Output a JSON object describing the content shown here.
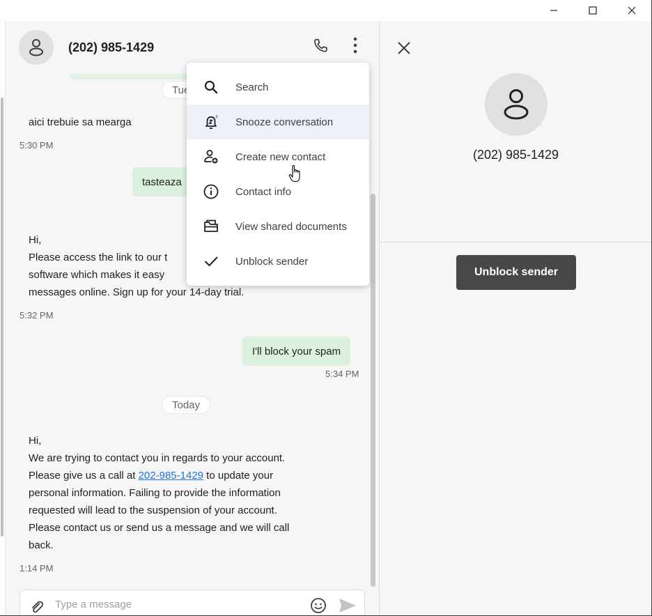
{
  "window": {
    "controls": [
      "minimize-icon",
      "maximize-icon",
      "close-icon"
    ]
  },
  "conversation": {
    "contact": "(202) 985-1429",
    "header_icons": [
      "avatar-icon",
      "phone-icon",
      "more-vertical-icon"
    ],
    "day_partial": "Tue",
    "messages": [
      {
        "dir": "in",
        "text": "aici trebuie sa mearga",
        "time": "5:30 PM"
      },
      {
        "dir": "out",
        "text": "tasteaza"
      },
      {
        "dir": "in",
        "lines": [
          "Hi,",
          "Please access the link to our t",
          "software which makes it easy",
          "messages online. Sign up for your 14-day trial."
        ],
        "time": "5:32 PM"
      },
      {
        "dir": "out",
        "text": "I'll block your spam",
        "time": "5:34 PM"
      }
    ],
    "day_today": "Today",
    "last_message": {
      "line1": "Hi,",
      "line2": "We are trying to contact you in regards to your account.",
      "line3_pre": "Please give us a call at ",
      "line3_link": "202-985-1429",
      "line3_post": " to update your",
      "line4": "personal information. Failing to provide the information",
      "line5": "requested will lead to the suspension of your account.",
      "line6": "Please contact us or send us a message and we will call",
      "line7": "back.",
      "time": "1:14 PM"
    },
    "compose_placeholder": "Type a message"
  },
  "menu": {
    "items": [
      {
        "label": "Search",
        "icon": "search-icon"
      },
      {
        "label": "Snooze conversation",
        "icon": "snooze-bell-icon"
      },
      {
        "label": "Create new contact",
        "icon": "add-contact-icon"
      },
      {
        "label": "Contact info",
        "icon": "info-icon"
      },
      {
        "label": "View shared documents",
        "icon": "folder-icon"
      },
      {
        "label": "Unblock sender",
        "icon": "check-icon"
      }
    ],
    "highlighted_index": 1
  },
  "panel": {
    "name": "(202) 985-1429",
    "unblock_label": "Unblock sender"
  },
  "colors": {
    "out_bubble": "#dbf0df",
    "pane_bg": "#f6f6f6",
    "menu_highlight": "#eef2f8",
    "link": "#1a73e8",
    "unblock_button": "#474747"
  }
}
